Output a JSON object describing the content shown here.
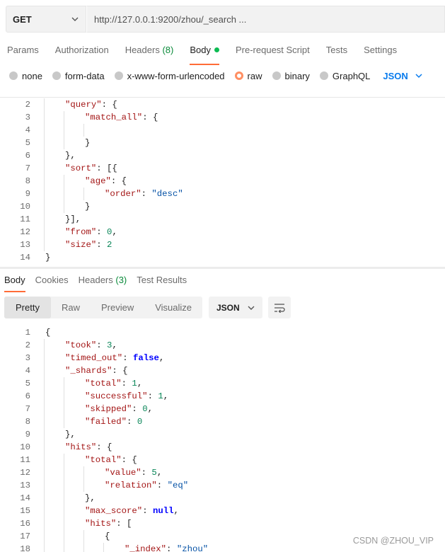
{
  "request": {
    "method": "GET",
    "url": "http://127.0.0.1:9200/zhou/_search ..."
  },
  "request_tabs": [
    {
      "label": "Params"
    },
    {
      "label": "Authorization"
    },
    {
      "label": "Headers",
      "count": "(8)"
    },
    {
      "label": "Body",
      "active": true
    },
    {
      "label": "Pre-request Script"
    },
    {
      "label": "Tests"
    },
    {
      "label": "Settings"
    }
  ],
  "body_types": [
    {
      "label": "none"
    },
    {
      "label": "form-data"
    },
    {
      "label": "x-www-form-urlencoded"
    },
    {
      "label": "raw",
      "selected": true
    },
    {
      "label": "binary"
    },
    {
      "label": "GraphQL"
    }
  ],
  "body_format": "JSON",
  "request_body_lines": [
    {
      "n": "2",
      "depth": 1,
      "tokens": [
        [
          "k",
          "\"query\""
        ],
        [
          "p",
          ": {"
        ]
      ]
    },
    {
      "n": "3",
      "depth": 2,
      "tokens": [
        [
          "k",
          "\"match_all\""
        ],
        [
          "p",
          ": {"
        ]
      ]
    },
    {
      "n": "4",
      "depth": 3,
      "tokens": []
    },
    {
      "n": "5",
      "depth": 2,
      "tokens": [
        [
          "p",
          "}"
        ]
      ]
    },
    {
      "n": "6",
      "depth": 1,
      "tokens": [
        [
          "p",
          "},"
        ]
      ]
    },
    {
      "n": "7",
      "depth": 1,
      "tokens": [
        [
          "k",
          "\"sort\""
        ],
        [
          "p",
          ": [{"
        ]
      ]
    },
    {
      "n": "8",
      "depth": 2,
      "tokens": [
        [
          "k",
          "\"age\""
        ],
        [
          "p",
          ": {"
        ]
      ]
    },
    {
      "n": "9",
      "depth": 3,
      "tokens": [
        [
          "k",
          "\"order\""
        ],
        [
          "p",
          ": "
        ],
        [
          "s",
          "\"desc\""
        ]
      ]
    },
    {
      "n": "10",
      "depth": 2,
      "tokens": [
        [
          "p",
          "}"
        ]
      ]
    },
    {
      "n": "11",
      "depth": 1,
      "tokens": [
        [
          "p",
          "}],"
        ]
      ]
    },
    {
      "n": "12",
      "depth": 1,
      "tokens": [
        [
          "k",
          "\"from\""
        ],
        [
          "p",
          ": "
        ],
        [
          "n",
          "0"
        ],
        [
          "p",
          ","
        ]
      ]
    },
    {
      "n": "13",
      "depth": 1,
      "tokens": [
        [
          "k",
          "\"size\""
        ],
        [
          "p",
          ": "
        ],
        [
          "n",
          "2"
        ]
      ]
    },
    {
      "n": "14",
      "depth": 0,
      "tokens": [
        [
          "p",
          "}"
        ]
      ]
    }
  ],
  "response_tabs": [
    {
      "label": "Body",
      "active": true
    },
    {
      "label": "Cookies"
    },
    {
      "label": "Headers",
      "count": "(3)"
    },
    {
      "label": "Test Results"
    }
  ],
  "view_modes": [
    {
      "label": "Pretty",
      "active": true
    },
    {
      "label": "Raw"
    },
    {
      "label": "Preview"
    },
    {
      "label": "Visualize"
    }
  ],
  "response_format": "JSON",
  "response_lines": [
    {
      "n": "1",
      "depth": 0,
      "tokens": [
        [
          "p",
          "{"
        ]
      ]
    },
    {
      "n": "2",
      "depth": 1,
      "tokens": [
        [
          "k",
          "\"took\""
        ],
        [
          "p",
          ": "
        ],
        [
          "n",
          "3"
        ],
        [
          "p",
          ","
        ]
      ]
    },
    {
      "n": "3",
      "depth": 1,
      "tokens": [
        [
          "k",
          "\"timed_out\""
        ],
        [
          "p",
          ": "
        ],
        [
          "kw",
          "false"
        ],
        [
          "p",
          ","
        ]
      ]
    },
    {
      "n": "4",
      "depth": 1,
      "tokens": [
        [
          "k",
          "\"_shards\""
        ],
        [
          "p",
          ": {"
        ]
      ]
    },
    {
      "n": "5",
      "depth": 2,
      "tokens": [
        [
          "k",
          "\"total\""
        ],
        [
          "p",
          ": "
        ],
        [
          "n",
          "1"
        ],
        [
          "p",
          ","
        ]
      ]
    },
    {
      "n": "6",
      "depth": 2,
      "tokens": [
        [
          "k",
          "\"successful\""
        ],
        [
          "p",
          ": "
        ],
        [
          "n",
          "1"
        ],
        [
          "p",
          ","
        ]
      ]
    },
    {
      "n": "7",
      "depth": 2,
      "tokens": [
        [
          "k",
          "\"skipped\""
        ],
        [
          "p",
          ": "
        ],
        [
          "n",
          "0"
        ],
        [
          "p",
          ","
        ]
      ]
    },
    {
      "n": "8",
      "depth": 2,
      "tokens": [
        [
          "k",
          "\"failed\""
        ],
        [
          "p",
          ": "
        ],
        [
          "n",
          "0"
        ]
      ]
    },
    {
      "n": "9",
      "depth": 1,
      "tokens": [
        [
          "p",
          "},"
        ]
      ]
    },
    {
      "n": "10",
      "depth": 1,
      "tokens": [
        [
          "k",
          "\"hits\""
        ],
        [
          "p",
          ": {"
        ]
      ]
    },
    {
      "n": "11",
      "depth": 2,
      "tokens": [
        [
          "k",
          "\"total\""
        ],
        [
          "p",
          ": {"
        ]
      ]
    },
    {
      "n": "12",
      "depth": 3,
      "tokens": [
        [
          "k",
          "\"value\""
        ],
        [
          "p",
          ": "
        ],
        [
          "n",
          "5"
        ],
        [
          "p",
          ","
        ]
      ]
    },
    {
      "n": "13",
      "depth": 3,
      "tokens": [
        [
          "k",
          "\"relation\""
        ],
        [
          "p",
          ": "
        ],
        [
          "s",
          "\"eq\""
        ]
      ]
    },
    {
      "n": "14",
      "depth": 2,
      "tokens": [
        [
          "p",
          "},"
        ]
      ]
    },
    {
      "n": "15",
      "depth": 2,
      "tokens": [
        [
          "k",
          "\"max_score\""
        ],
        [
          "p",
          ": "
        ],
        [
          "kw",
          "null"
        ],
        [
          "p",
          ","
        ]
      ]
    },
    {
      "n": "16",
      "depth": 2,
      "tokens": [
        [
          "k",
          "\"hits\""
        ],
        [
          "p",
          ": ["
        ]
      ]
    },
    {
      "n": "17",
      "depth": 3,
      "tokens": [
        [
          "p",
          "{"
        ]
      ]
    },
    {
      "n": "18",
      "depth": 4,
      "tokens": [
        [
          "k",
          "\"_index\""
        ],
        [
          "p",
          ": "
        ],
        [
          "s",
          "\"zhou\""
        ]
      ]
    }
  ],
  "watermark": "CSDN @ZHOU_VIP"
}
